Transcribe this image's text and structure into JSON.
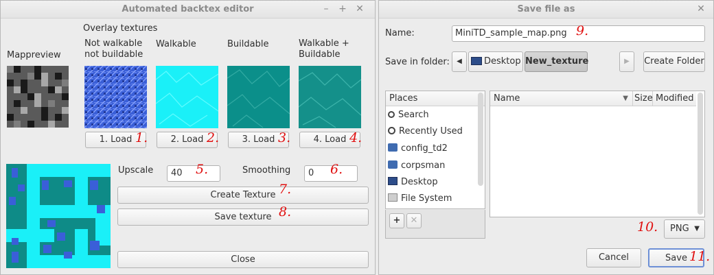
{
  "backtex": {
    "title": "Automated backtex editor",
    "mappreview_label": "Mappreview",
    "overlay_heading": "Overlay textures",
    "columns": [
      {
        "label": "Not walkable\nnot buildable",
        "load": "1. Load",
        "mark": "1."
      },
      {
        "label": "Walkable",
        "load": "2. Load",
        "mark": "2."
      },
      {
        "label": "Buildable",
        "load": "3. Load",
        "mark": "3."
      },
      {
        "label": "Walkable +\nBuildable",
        "load": "4. Load",
        "mark": "4."
      }
    ],
    "upscale_label": "Upscale",
    "upscale_value": "40",
    "upscale_mark": "5.",
    "smoothing_label": "Smoothing",
    "smoothing_value": "0",
    "smoothing_mark": "6.",
    "create_label": "Create Texture",
    "create_mark": "7.",
    "save_label": "Save texture",
    "save_mark": "8.",
    "close_label": "Close",
    "colors": {
      "walkable": "#00ffff",
      "buildable": "#008b8b",
      "blocked": "#3a5fd8"
    }
  },
  "savedlg": {
    "title": "Save file as",
    "name_label": "Name:",
    "name_value": "MiniTD_sample_map.png",
    "name_mark": "9.",
    "folder_label": "Save in folder:",
    "path_desktop": "Desktop",
    "path_current": "New_texture",
    "create_folder": "Create Folder",
    "places_header": "Places",
    "places": [
      "Search",
      "Recently Used",
      "config_td2",
      "corpsman",
      "Desktop",
      "File System"
    ],
    "col_name": "Name",
    "col_size": "Size",
    "col_modified": "Modified",
    "filetype": "PNG",
    "filetype_mark": "10.",
    "cancel": "Cancel",
    "save": "Save",
    "save_mark": "11."
  }
}
